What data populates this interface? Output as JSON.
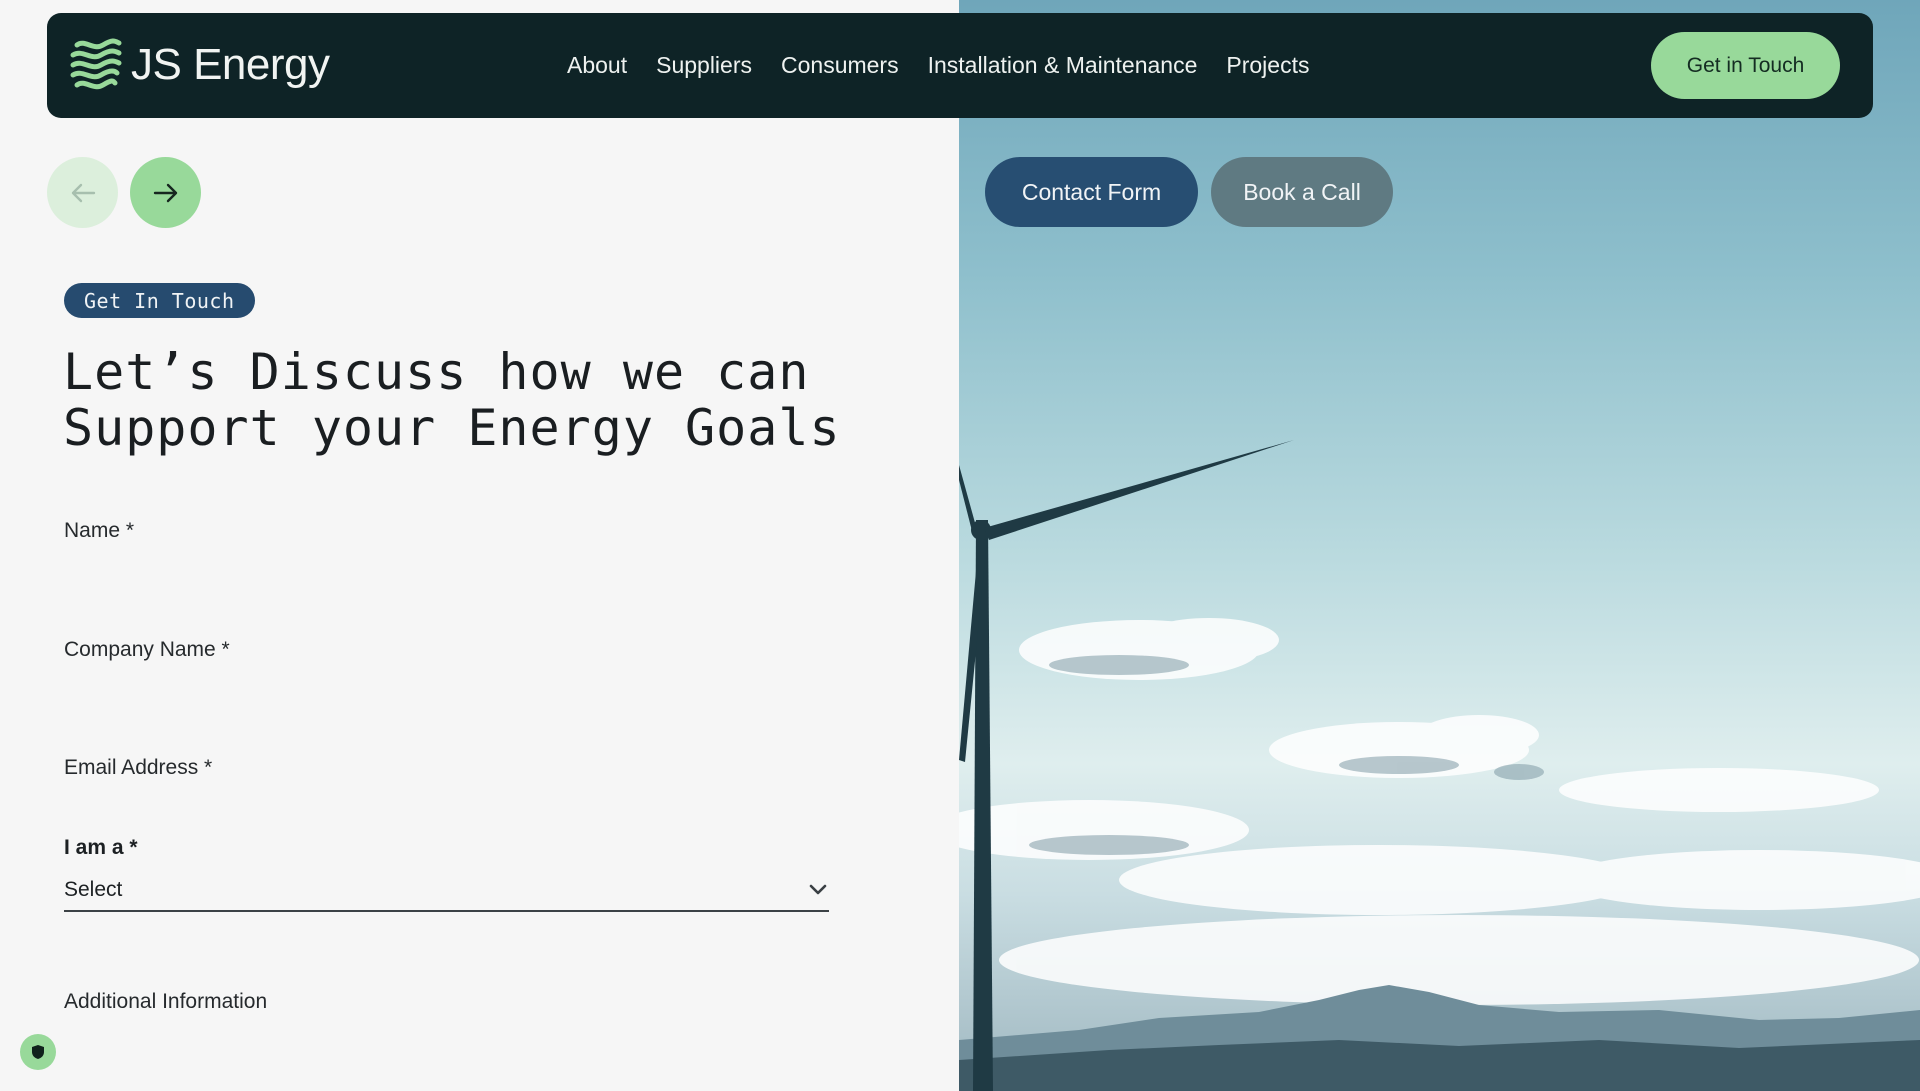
{
  "brand": {
    "name": "JS Energy"
  },
  "nav": {
    "items": [
      {
        "label": "About"
      },
      {
        "label": "Suppliers"
      },
      {
        "label": "Consumers"
      },
      {
        "label": "Installation & Maintenance"
      },
      {
        "label": "Projects"
      }
    ],
    "cta_label": "Get in Touch"
  },
  "tabs": {
    "contact_label": "Contact Form",
    "book_label": "Book a Call"
  },
  "section": {
    "pill": "Get In Touch",
    "heading_line1": "Let’s Discuss how we can",
    "heading_line2": "Support your Energy Goals"
  },
  "form": {
    "name_label": "Name *",
    "company_label": "Company Name *",
    "email_label": "Email Address *",
    "role_label": "I am a *",
    "role_value": "Select",
    "additional_label": "Additional Information"
  },
  "icons": {
    "arrow_prev": "arrow-left-icon",
    "arrow_next": "arrow-right-icon",
    "select_chevron": "chevron-down-icon",
    "privacy_badge": "shield-icon"
  },
  "colors": {
    "header_bg": "#0e2326",
    "accent_green": "#98d99a",
    "pill_blue": "#264b6f",
    "tab_contact": "#274e72",
    "tab_book": "#5f7a82"
  }
}
